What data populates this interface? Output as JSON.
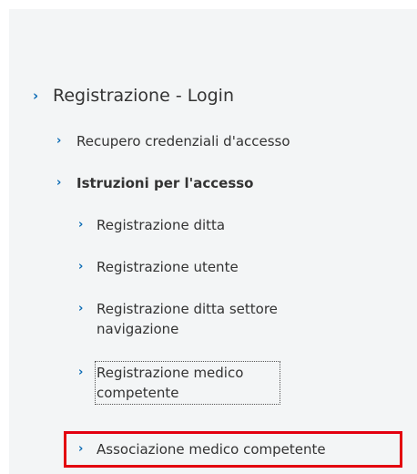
{
  "nav": {
    "level1": {
      "label": "Registrazione - Login"
    },
    "level2": [
      {
        "label": "Recupero credenziali d'accesso"
      },
      {
        "label": "Istruzioni per l'accesso"
      }
    ],
    "level3": [
      {
        "label": "Registrazione ditta"
      },
      {
        "label": "Registrazione utente"
      },
      {
        "label": "Registrazione ditta settore navigazione"
      },
      {
        "label": "Registrazione medico competente"
      },
      {
        "label": "Associazione medico competente"
      }
    ],
    "chevron_glyph": "›"
  },
  "colors": {
    "panel_background": "#f3f5f6",
    "chevron": "#0a6bb5",
    "highlight_border": "#e3000f"
  }
}
